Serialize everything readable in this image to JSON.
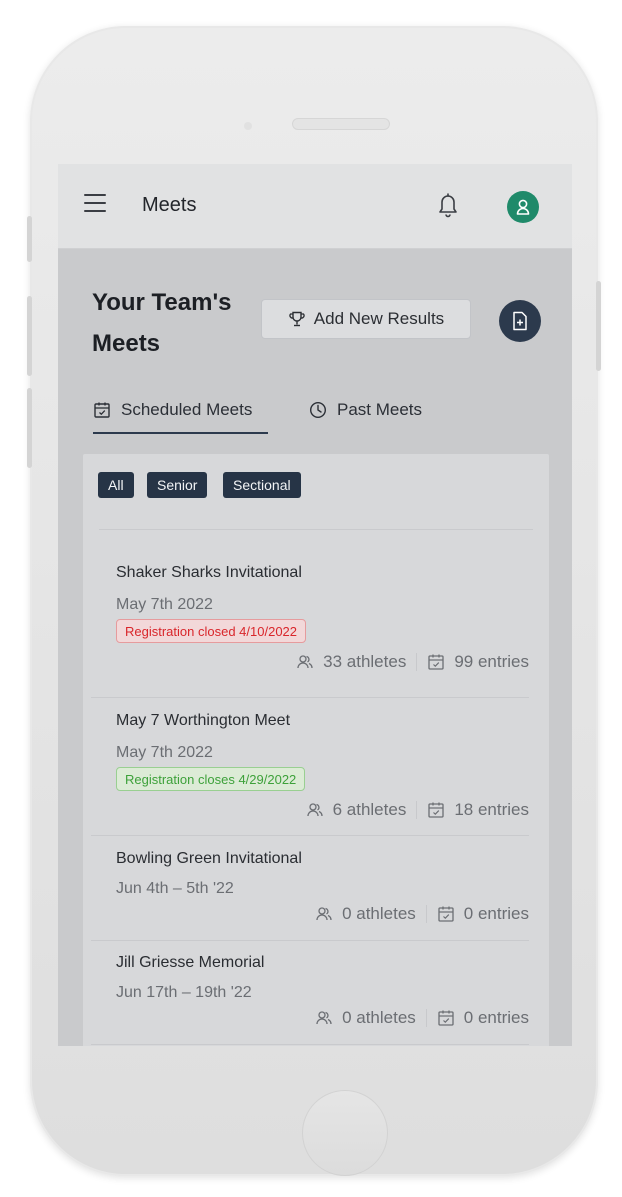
{
  "header": {
    "title": "Meets"
  },
  "page": {
    "title": "Your Team's Meets",
    "add_button_label": "Add New Results"
  },
  "tabs": [
    {
      "label": "Scheduled Meets",
      "active": true
    },
    {
      "label": "Past Meets",
      "active": false
    }
  ],
  "filters": [
    "All",
    "Senior",
    "Sectional"
  ],
  "meets": [
    {
      "name": "Shaker Sharks Invitational",
      "date": "May 7th 2022",
      "registration": "Registration closed 4/10/2022",
      "registration_status": "closed",
      "athletes": "33 athletes",
      "entries": "99 entries"
    },
    {
      "name": "May 7 Worthington Meet",
      "date": "May 7th 2022",
      "registration": "Registration closes 4/29/2022",
      "registration_status": "open",
      "athletes": "6 athletes",
      "entries": "18 entries"
    },
    {
      "name": "Bowling Green Invitational",
      "date": "Jun 4th – 5th '22",
      "athletes": "0 athletes",
      "entries": "0 entries"
    },
    {
      "name": "Jill Griesse Memorial",
      "date": "Jun 17th – 19th '22",
      "athletes": "0 athletes",
      "entries": "0 entries"
    }
  ],
  "icons": {
    "menu": "menu-icon",
    "bell": "bell-icon",
    "avatar": "user-icon",
    "trophy": "trophy-icon",
    "add_document": "document-add-icon",
    "calendar": "calendar-icon",
    "clock": "clock-icon",
    "athletes": "users-icon",
    "entries": "calendar-icon"
  },
  "colors": {
    "accent": "#263446",
    "avatar": "#1f8a6a",
    "closed_text": "#d9262b",
    "open_text": "#3da13a"
  }
}
